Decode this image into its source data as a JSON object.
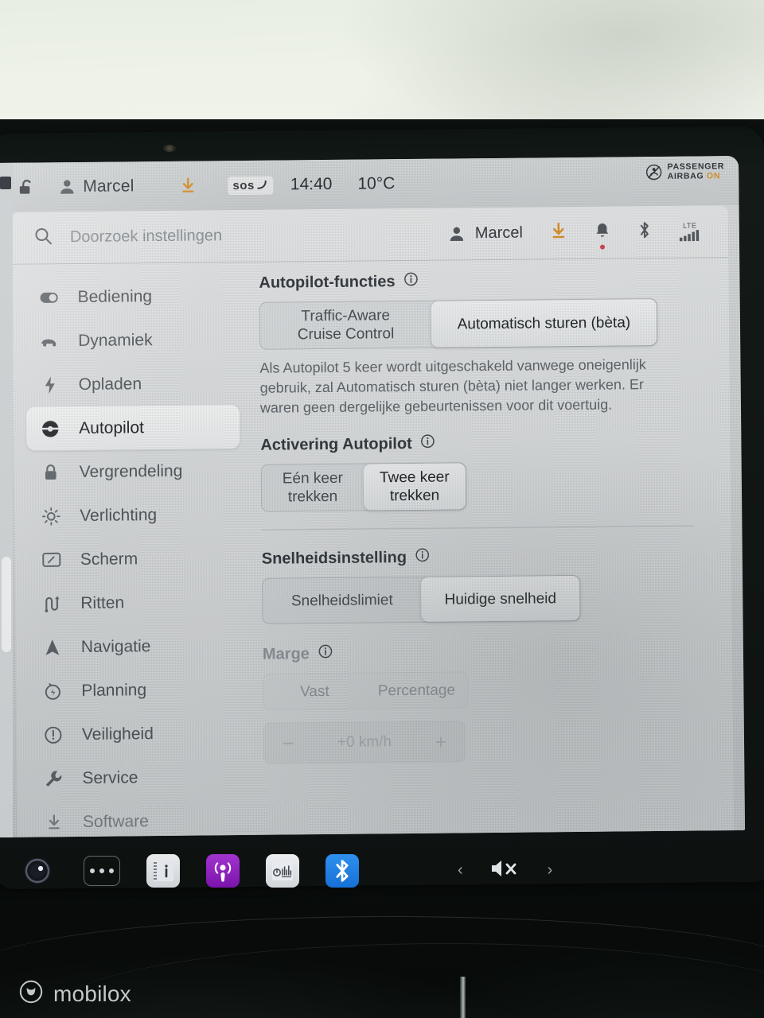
{
  "statusbar": {
    "lock_icon": "unlock-icon",
    "profile_icon": "person-icon",
    "driver_name": "Marcel",
    "download_icon": "download-icon",
    "sos_label": "sos",
    "time": "14:40",
    "temperature": "10°C",
    "airbag": {
      "icon": "passenger-airbag-off-icon",
      "line1": "PASSENGER",
      "line2": "AIRBAG",
      "state": "ON"
    }
  },
  "search": {
    "placeholder": "Doorzoek instellingen",
    "value": "",
    "user_label": "Marcel",
    "icons": {
      "search": "search-icon",
      "person": "person-icon",
      "download": "download-icon",
      "bell": "bell-icon",
      "bluetooth": "bluetooth-icon",
      "signal": "lte-signal-icon"
    },
    "signal_label": "LTE"
  },
  "sidebar": {
    "items": [
      {
        "label": "Bediening",
        "icon": "toggle-icon",
        "active": false,
        "dim": false
      },
      {
        "label": "Dynamiek",
        "icon": "car-icon",
        "active": false,
        "dim": false
      },
      {
        "label": "Opladen",
        "icon": "bolt-icon",
        "active": false,
        "dim": false
      },
      {
        "label": "Autopilot",
        "icon": "steering-wheel-icon",
        "active": true,
        "dim": false
      },
      {
        "label": "Vergrendeling",
        "icon": "lock-icon",
        "active": false,
        "dim": false
      },
      {
        "label": "Verlichting",
        "icon": "sun-icon",
        "active": false,
        "dim": false
      },
      {
        "label": "Scherm",
        "icon": "display-icon",
        "active": false,
        "dim": false
      },
      {
        "label": "Ritten",
        "icon": "trip-icon",
        "active": false,
        "dim": false
      },
      {
        "label": "Navigatie",
        "icon": "navigation-arrow-icon",
        "active": false,
        "dim": false
      },
      {
        "label": "Planning",
        "icon": "schedule-clock-icon",
        "active": false,
        "dim": false
      },
      {
        "label": "Veiligheid",
        "icon": "alert-circle-icon",
        "active": false,
        "dim": false
      },
      {
        "label": "Service",
        "icon": "wrench-icon",
        "active": false,
        "dim": false
      },
      {
        "label": "Software",
        "icon": "download-icon",
        "active": false,
        "dim": true
      }
    ]
  },
  "content": {
    "autopilot_features": {
      "title": "Autopilot-functies",
      "info_icon": "info-icon",
      "option_1": "Traffic-Aware\nCruise Control",
      "option_1_line1": "Traffic-Aware",
      "option_1_line2": "Cruise Control",
      "option_2": "Automatisch sturen (bèta)",
      "selected": "Automatisch sturen (bèta)",
      "help_text": "Als Autopilot 5 keer wordt uitgeschakeld vanwege oneigenlijk gebruik, zal Automatisch sturen (bèta) niet langer werken. Er waren geen dergelijke gebeurtenissen voor dit voertuig."
    },
    "autopilot_activation": {
      "title": "Activering Autopilot",
      "info_icon": "info-icon",
      "option_1_line1": "Eén keer",
      "option_1_line2": "trekken",
      "option_2_line1": "Twee keer",
      "option_2_line2": "trekken",
      "selected": "Twee keer trekken"
    },
    "speed_setting": {
      "title": "Snelheidsinstelling",
      "info_icon": "info-icon",
      "option_1": "Snelheidslimiet",
      "option_2": "Huidige snelheid",
      "selected": "Huidige snelheid"
    },
    "margin": {
      "title": "Marge",
      "info_icon": "info-icon",
      "option_1": "Vast",
      "option_2": "Percentage",
      "stepper": {
        "minus": "−",
        "value": "+0 km/h",
        "plus": "+"
      },
      "disabled": true
    }
  },
  "taskbar": {
    "items": [
      {
        "name": "camera-icon",
        "label": ""
      },
      {
        "name": "more-dots-icon",
        "label": ""
      },
      {
        "name": "owners-manual-icon",
        "label": ""
      },
      {
        "name": "podcast-icon",
        "label": ""
      },
      {
        "name": "radio-tuner-icon",
        "label": ""
      },
      {
        "name": "bluetooth-icon",
        "label": ""
      }
    ],
    "prev_chevron": "‹",
    "next_chevron": "›",
    "volume_icon": "volume-muted-icon"
  },
  "watermark": {
    "text": "mobilox",
    "logo_icon": "mobilox-logo-icon"
  },
  "colors": {
    "accent_orange": "#d98a1a",
    "notification_red": "#cc3a4a",
    "bluetooth_blue": "#1670d6",
    "podcast_purple": "#8a1fc0",
    "panel_gray": "#cfd3d4"
  }
}
